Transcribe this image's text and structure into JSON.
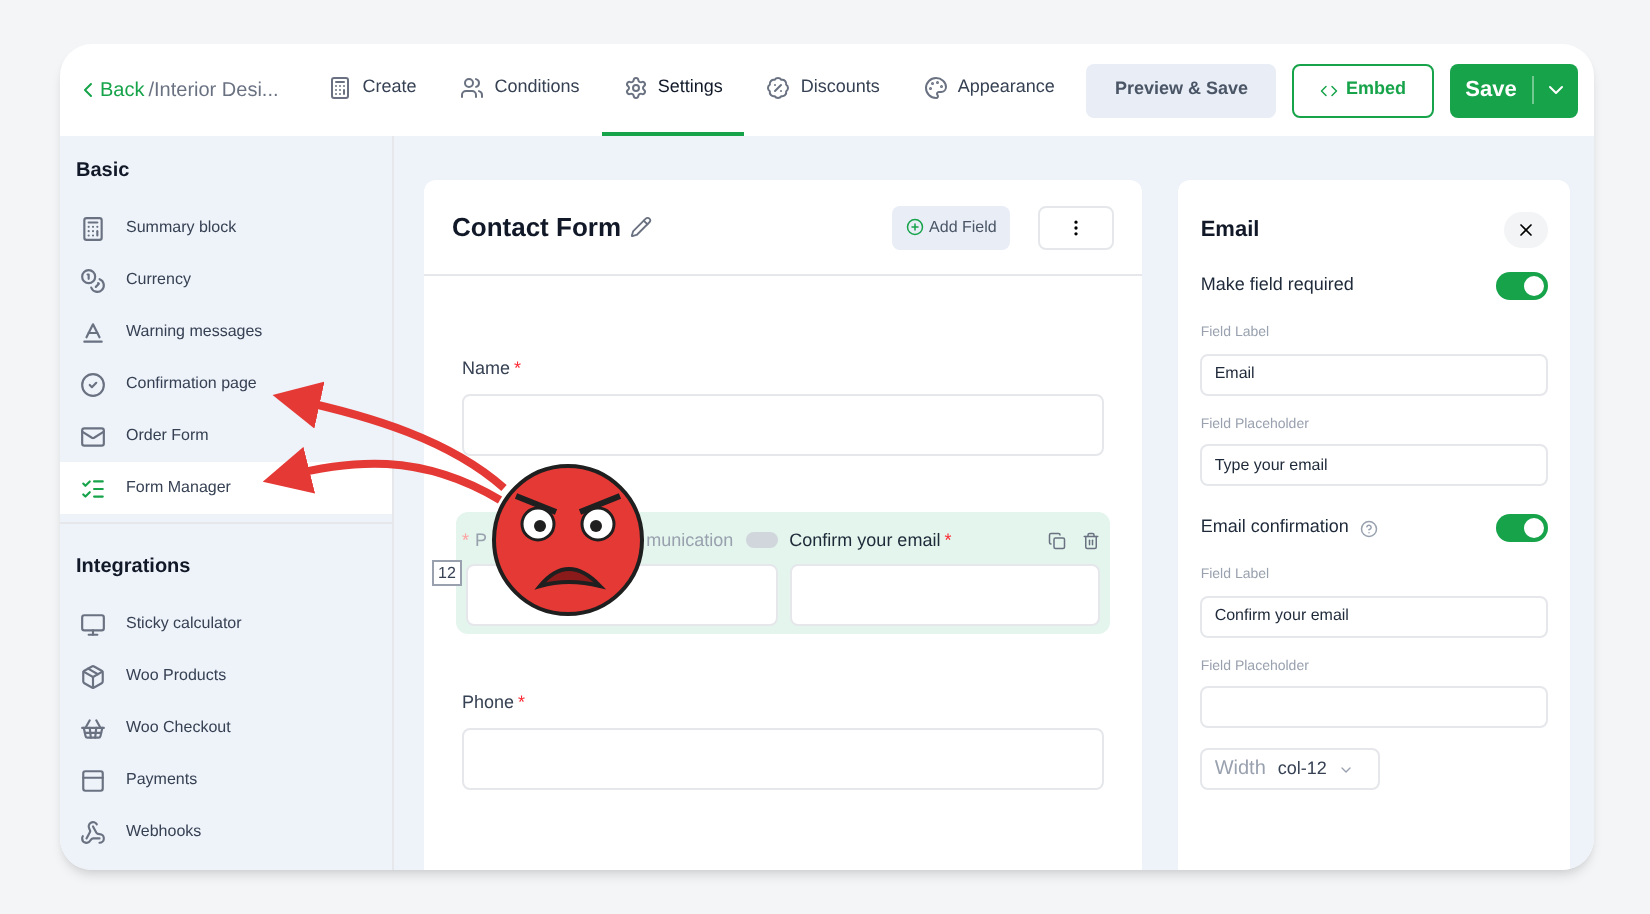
{
  "header": {
    "back": "Back",
    "breadcrumb": "/Interior Desi...",
    "tabs": [
      {
        "label": "Create",
        "selected": false
      },
      {
        "label": "Conditions",
        "selected": false
      },
      {
        "label": "Settings",
        "selected": true
      },
      {
        "label": "Discounts",
        "selected": false
      },
      {
        "label": "Appearance",
        "selected": false
      }
    ],
    "preview": "Preview & Save",
    "embed": "Embed",
    "save": "Save"
  },
  "sidebar": {
    "sections": [
      {
        "title": "Basic",
        "items": [
          {
            "label": "Summary block",
            "selected": false
          },
          {
            "label": "Currency",
            "selected": false
          },
          {
            "label": "Warning messages",
            "selected": false
          },
          {
            "label": "Confirmation page",
            "selected": false
          },
          {
            "label": "Order Form",
            "selected": false
          },
          {
            "label": "Form Manager",
            "selected": true
          }
        ]
      },
      {
        "title": "Integrations",
        "items": [
          {
            "label": "Sticky calculator",
            "selected": false
          },
          {
            "label": "Woo Products",
            "selected": false
          },
          {
            "label": "Woo Checkout",
            "selected": false
          },
          {
            "label": "Payments",
            "selected": false
          },
          {
            "label": "Webhooks",
            "selected": false
          }
        ]
      }
    ]
  },
  "form": {
    "title": "Contact Form",
    "add_field": "Add Field",
    "fields": [
      {
        "kind": "single",
        "label": "Name",
        "required_mark": "*"
      },
      {
        "kind": "pair",
        "start_mark": "*",
        "label_start": "P",
        "label_end": "munication",
        "toggle_on": false,
        "width_badge": "12",
        "label": "Confirm your email",
        "required_mark": "*"
      },
      {
        "kind": "single",
        "label": "Phone",
        "required_mark": "*"
      }
    ]
  },
  "panel": {
    "title": "Email",
    "rows": [
      {
        "kind": "toggle",
        "label": "Make field required",
        "on": true
      },
      {
        "kind": "input",
        "label": "Field Label",
        "value": "Email"
      },
      {
        "kind": "input",
        "label": "Field Placeholder",
        "value": "Type your email"
      },
      {
        "kind": "toggle",
        "label": "Email confirmation",
        "on": true,
        "help": true
      },
      {
        "kind": "input",
        "label": "Field Label",
        "value": "Confirm your email"
      },
      {
        "kind": "input",
        "label": "Field Placeholder"
      },
      {
        "kind": "select",
        "label": "Width",
        "value": "col-12"
      }
    ]
  }
}
